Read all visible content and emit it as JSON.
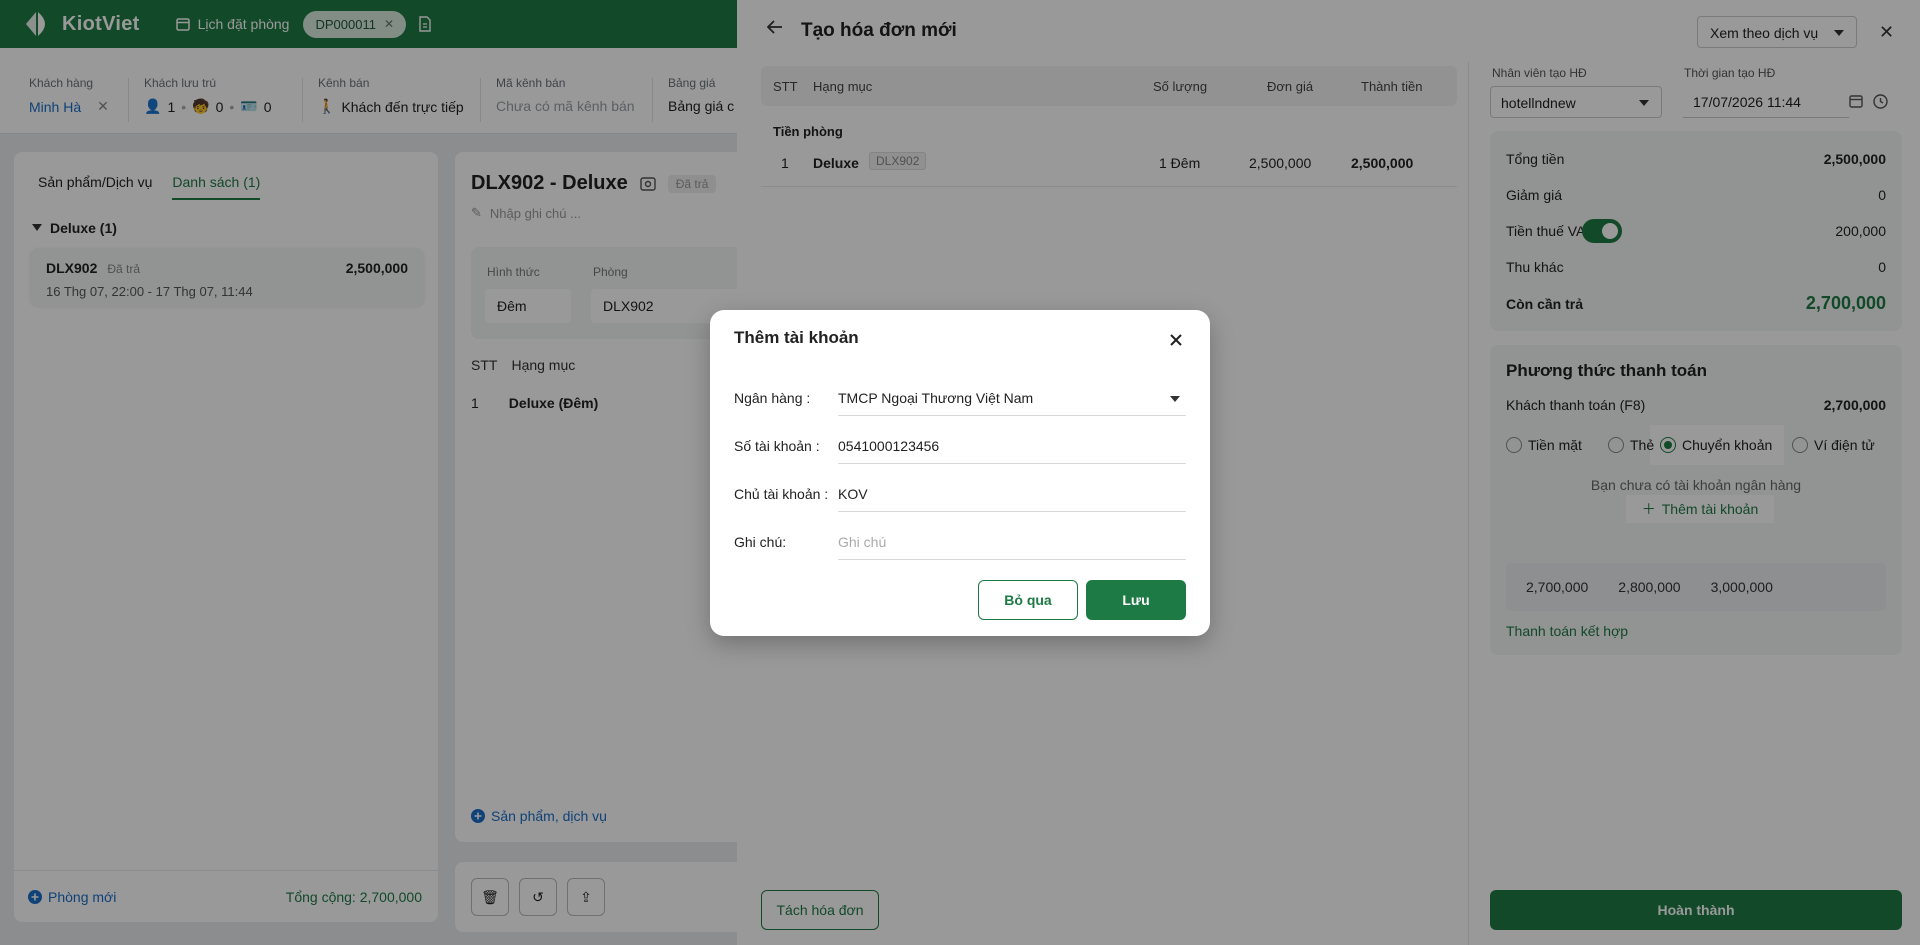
{
  "app": {
    "logo_text": "KiotViet",
    "nav_booking": "Lịch đặt phòng",
    "booking_code": "DP000011"
  },
  "info": {
    "customer_label": "Khách hàng",
    "customer_value": "Minh Hà",
    "guests_label": "Khách lưu trú",
    "guests_adults": "1",
    "guests_children": "0",
    "guests_cards": "0",
    "channel_label": "Kênh bán",
    "channel_value": "Khách đến trực tiếp",
    "channel_code_label": "Mã kênh bán",
    "channel_code_value": "Chưa có mã kênh bán",
    "pricebook_label": "Bảng giá",
    "pricebook_value": "Bảng giá c"
  },
  "left": {
    "tab1": "Sản phẩm/Dịch vụ",
    "tab2": "Danh sách (1)",
    "group": "Deluxe (1)",
    "room": {
      "name": "DLX902",
      "status": "Đã trả",
      "amount": "2,500,000",
      "dates": "16 Thg 07, 22:00 - 17 Thg 07, 11:44"
    },
    "new_room": "Phòng mới",
    "total": "Tổng cộng: 2,700,000"
  },
  "mid": {
    "title": "DLX902 - Deluxe",
    "tag": "Đã trả",
    "note_placeholder": "Nhập ghi chú ...",
    "form_label": "Hình thức",
    "form_value": "Đêm",
    "room_label": "Phòng",
    "room_value": "DLX902",
    "th_stt": "STT",
    "th_item": "Hạng mục",
    "row_stt": "1",
    "row_item": "Deluxe (Đêm)",
    "add_service": "Sản phẩm, dịch vụ"
  },
  "drawer": {
    "title": "Tạo hóa đơn mới",
    "view_mode": "Xem theo dịch vụ",
    "table_headers": {
      "stt": "STT",
      "item": "Hạng mục",
      "qty": "Số lượng",
      "unit_price": "Đơn giá",
      "amount": "Thành tiền"
    },
    "group": "Tiền phòng",
    "row": {
      "stt": "1",
      "item": "Deluxe",
      "code": "DLX902",
      "qty": "1 Đêm",
      "unit_price": "2,500,000",
      "amount": "2,500,000"
    },
    "split_button": "Tách hóa đơn",
    "staff_label": "Nhân viên tạo HĐ",
    "staff_value": "hotellndnew",
    "time_label": "Thời gian tạo HĐ",
    "time_value": "17/07/2026 11:44",
    "summary": {
      "total_label": "Tổng tiền",
      "total_value": "2,500,000",
      "discount_label": "Giảm giá",
      "discount_value": "0",
      "vat_label": "Tiền thuế VAT",
      "vat_value": "200,000",
      "vat_enabled": true,
      "other_label": "Thu khác",
      "other_value": "0",
      "due_label": "Còn cần trả",
      "due_value": "2,700,000"
    },
    "payment": {
      "title": "Phương thức thanh toán",
      "paid_label": "Khách thanh toán (F8)",
      "paid_value": "2,700,000",
      "methods": [
        "Tiền mặt",
        "Thẻ",
        "Chuyển khoản",
        "Ví điện tử"
      ],
      "selected_method": "Chuyển khoản",
      "no_account": "Bạn chưa có tài khoản ngân hàng",
      "add_account": "Thêm tài khoản",
      "quick_amounts": [
        "2,700,000",
        "2,800,000",
        "3,000,000"
      ],
      "combined": "Thanh toán kết hợp"
    },
    "complete_button": "Hoàn thành"
  },
  "modal": {
    "title": "Thêm tài khoản",
    "bank_label": "Ngân hàng :",
    "bank_value": "TMCP Ngoại Thương Việt Nam",
    "account_no_label": "Số tài khoản :",
    "account_no_value": "0541000123456",
    "holder_label": "Chủ tài khoản :",
    "holder_value": "KOV",
    "note_label": "Ghi chú:",
    "note_placeholder": "Ghi chú",
    "cancel_button": "Bỏ qua",
    "save_button": "Lưu"
  },
  "colors": {
    "brand": "#1e7a45",
    "link": "#1a6fc9",
    "overlay": "rgba(0,0,0,0.4)"
  }
}
